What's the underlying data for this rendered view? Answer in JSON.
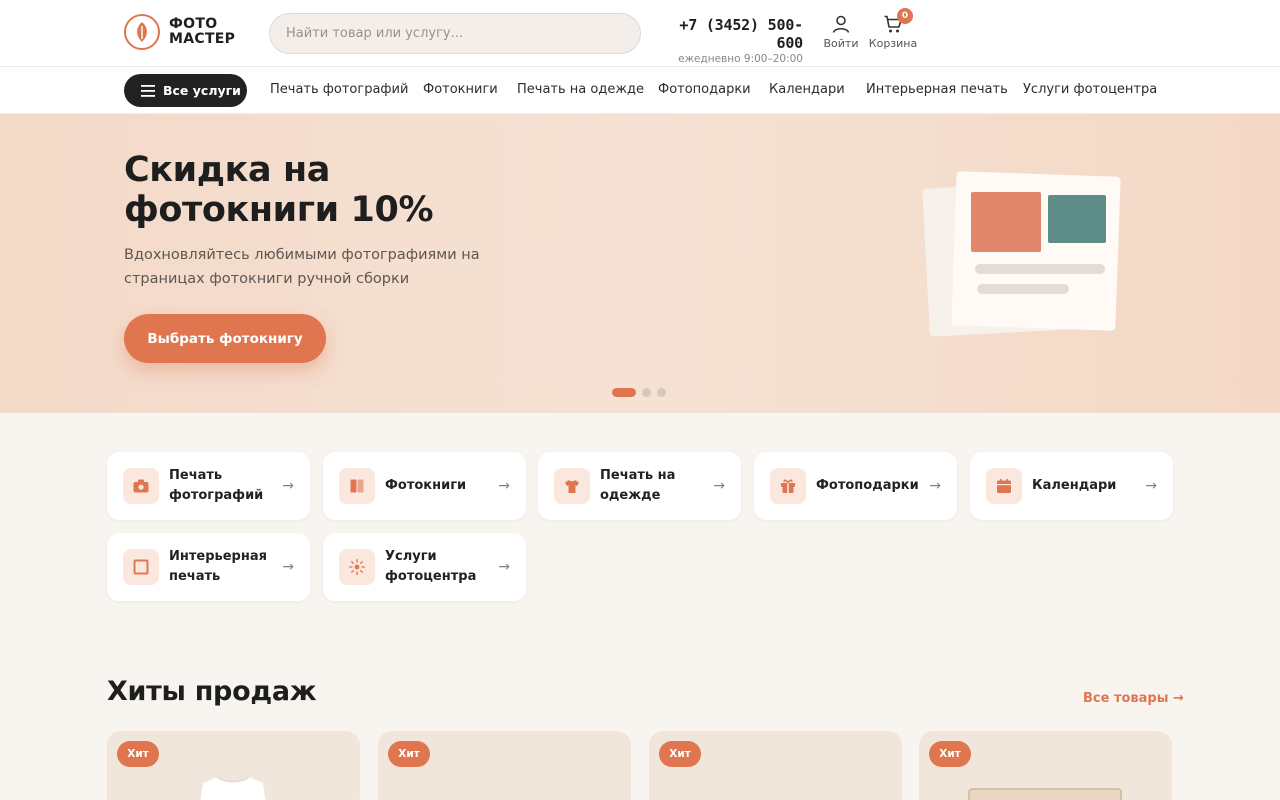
{
  "header": {
    "logo_line1": "ФОТО",
    "logo_line2": "МАСТЕР",
    "search_placeholder": "Найти товар или услугу...",
    "phone": "+7 (3452) 500-600",
    "hours": "ежедневно 9:00–20:00",
    "login_label": "Войти",
    "cart_label": "Корзина",
    "cart_count": "0"
  },
  "nav": {
    "all_services": "Все услуги",
    "items": [
      "Печать фотографий",
      "Фотокниги",
      "Печать на одежде",
      "Фотоподарки",
      "Календари",
      "Интерьерная печать",
      "Услуги фотоцентра"
    ]
  },
  "hero": {
    "title_line1": "Скидка на",
    "title_line2": "фотокниги 10%",
    "subtitle": "Вдохновляйтесь любимыми фотографиями на страницах фотокниги ручной сборки",
    "button": "Выбрать фотокнигу",
    "slide_count": 3,
    "active_slide": 1
  },
  "categories": [
    {
      "label": "Печать фотографий",
      "icon": "camera-icon"
    },
    {
      "label": "Фотокниги",
      "icon": "book-icon"
    },
    {
      "label": "Печать на одежде",
      "icon": "tshirt-icon"
    },
    {
      "label": "Фотоподарки",
      "icon": "gift-icon"
    },
    {
      "label": "Календари",
      "icon": "calendar-icon"
    },
    {
      "label": "Интерьерная печать",
      "icon": "frame-icon"
    },
    {
      "label": "Услуги фотоцентра",
      "icon": "sparkle-icon"
    }
  ],
  "bestsellers": {
    "title": "Хиты продаж",
    "all_link": "Все товары →",
    "badge": "Хит"
  },
  "colors": {
    "accent": "#e0764f",
    "dark": "#222222",
    "hero_bg": "#f4dccb",
    "teal": "#5e8c86",
    "page_bg": "#f8f5f1"
  }
}
